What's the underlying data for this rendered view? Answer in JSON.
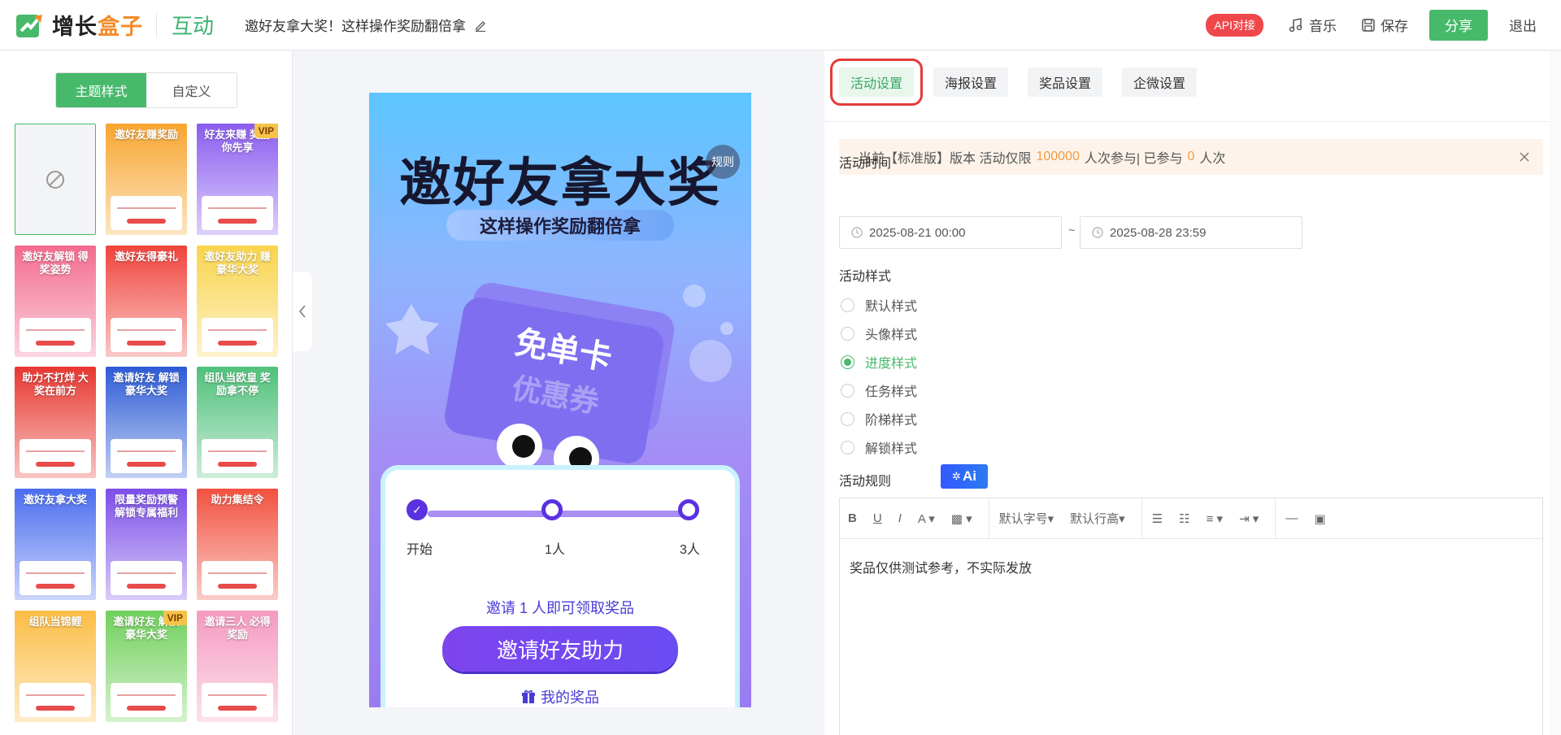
{
  "header": {
    "brand_a": "增长",
    "brand_b": "盒子",
    "module": "互动",
    "doc_title": "邀好友拿大奖！这样操作奖励翻倍拿",
    "api_badge": "API对接",
    "music": "音乐",
    "save": "保存",
    "share": "分享",
    "quit": "退出",
    "brand_color": "#47b96b"
  },
  "left": {
    "seg_theme": "主题样式",
    "seg_custom": "自定义",
    "templates": [
      {
        "title": "",
        "bg": "#f3f4f6"
      },
      {
        "title": "邀好友赚奖励",
        "bg": "#f7a52f",
        "vip": ""
      },
      {
        "title": "好友来赚 奖励你先享",
        "bg": "#8a5cf0",
        "vip": "VIP"
      },
      {
        "title": "邀好友解锁 得奖姿势",
        "bg": "#f36b8f"
      },
      {
        "title": "邀好友得豪礼",
        "bg": "#f0433b"
      },
      {
        "title": "邀好友助力 赚豪华大奖",
        "bg": "#f9d44b"
      },
      {
        "title": "助力不打烊 大奖在前方",
        "bg": "#e8362f"
      },
      {
        "title": "邀请好友 解锁豪华大奖",
        "bg": "#2d5bd6"
      },
      {
        "title": "组队当欧皇 奖励拿不停",
        "bg": "#4fc17a"
      },
      {
        "title": "邀好友拿大奖",
        "bg": "#4b6df0"
      },
      {
        "title": "限量奖励预警 解锁专属福利",
        "bg": "#7c4ee8"
      },
      {
        "title": "助力集结令",
        "bg": "#f2513f"
      },
      {
        "title": "组队当锦鲤",
        "bg": "#fbbd45"
      },
      {
        "title": "邀请好友 解锁豪华大奖",
        "bg": "#6fd05a",
        "vip": "VIP"
      },
      {
        "title": "邀请三人 必得奖励",
        "bg": "#f59ac0"
      }
    ]
  },
  "preview": {
    "title": "邀好友拿大奖",
    "rule": "规则",
    "subtitle": "这样操作奖励翻倍拿",
    "art_text_1": "免单卡",
    "art_text_2": "优惠券",
    "progress_fraction": 0,
    "nodes": [
      "开始",
      "1人",
      "3人"
    ],
    "invite_text": "邀请 1 人即可领取奖品",
    "invite_button": "邀请好友助力",
    "my_prize": "我的奖品"
  },
  "right": {
    "tabs": [
      "活动设置",
      "海报设置",
      "奖品设置",
      "企微设置"
    ],
    "notice_prefix": "当前【标准版】版本 活动仅限",
    "notice_limit": "100000",
    "notice_mid": "人次参与| 已参与",
    "notice_used": "0",
    "notice_suffix": "人次",
    "time_label": "活动时间",
    "start_time": "2025-08-21 00:00",
    "tilde": "~",
    "end_time": "2025-08-28 23:59",
    "style_label": "活动样式",
    "styles": [
      "默认样式",
      "头像样式",
      "进度样式",
      "任务样式",
      "阶梯样式",
      "解锁样式"
    ],
    "selected_style": "进度样式",
    "rule_label": "活动规则",
    "ai_label": "Ai",
    "font_size": "默认字号",
    "line_height": "默认行高",
    "rule_text": "奖品仅供测试参考，不实际发放"
  }
}
